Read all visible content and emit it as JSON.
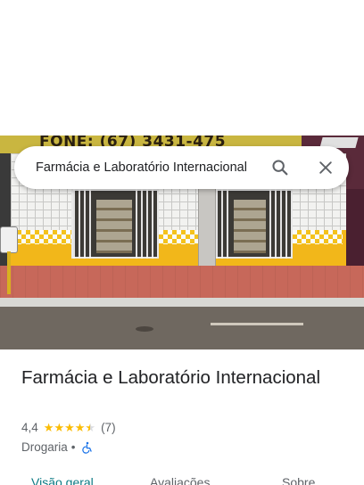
{
  "photo": {
    "sign_text": "FONE: (67) 3431-475"
  },
  "search": {
    "value": "Farmácia e Laboratório Internacional",
    "search_icon": "search-icon",
    "close_icon": "close-icon"
  },
  "place": {
    "title": "Farmácia e Laboratório Internacional",
    "rating": "4,4",
    "stars": 4.4,
    "review_count": "(7)",
    "category": "Drogaria",
    "separator": "•",
    "accessibility_icon": "wheelchair-icon"
  },
  "tabs": [
    {
      "label": "Visão geral",
      "active": true
    },
    {
      "label": "Avaliações",
      "active": false
    },
    {
      "label": "Sobre",
      "active": false
    }
  ],
  "colors": {
    "star": "#fbbc04",
    "active_tab": "#0b7a84",
    "accessibility": "#1a73e8"
  }
}
